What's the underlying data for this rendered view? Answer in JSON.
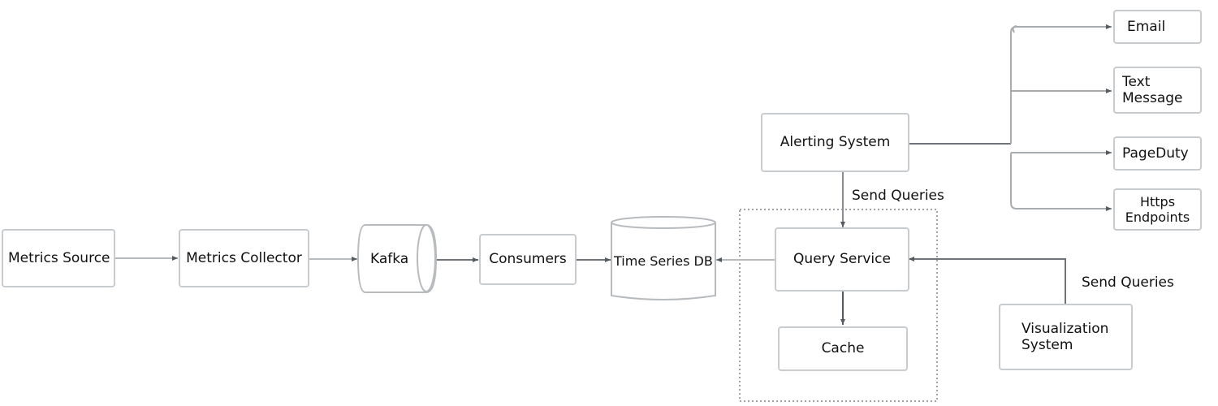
{
  "diagram": {
    "nodes": {
      "metrics_source": "Metrics Source",
      "metrics_collector": "Metrics Collector",
      "kafka": "Kafka",
      "consumers": "Consumers",
      "time_series_db": "Time Series DB",
      "query_service": "Query Service",
      "cache": "Cache",
      "alerting_system": "Alerting System",
      "visualization_system": "Visualization\nSystem",
      "email": "Email",
      "text_message": "Text\nMessage",
      "pageduty": "PageDuty",
      "https_endpoints": "Https\nEndpoints"
    },
    "edge_labels": {
      "alerting_to_query": "Send Queries",
      "visualization_to_query": "Send Queries"
    },
    "edges": [
      {
        "from": "Metrics Source",
        "to": "Metrics Collector"
      },
      {
        "from": "Metrics Collector",
        "to": "Kafka"
      },
      {
        "from": "Kafka",
        "to": "Consumers"
      },
      {
        "from": "Consumers",
        "to": "Time Series DB"
      },
      {
        "from": "Query Service",
        "to": "Time Series DB"
      },
      {
        "from": "Alerting System",
        "to": "Query Service",
        "label": "Send Queries"
      },
      {
        "from": "Visualization System",
        "to": "Query Service",
        "label": "Send Queries"
      },
      {
        "from": "Query Service",
        "to": "Cache"
      },
      {
        "from": "Alerting System",
        "to": "Email"
      },
      {
        "from": "Alerting System",
        "to": "Text Message"
      },
      {
        "from": "Alerting System",
        "to": "PageDuty"
      },
      {
        "from": "Alerting System",
        "to": "Https Endpoints"
      }
    ],
    "colors": {
      "edge": "#707478",
      "node_border": "#c9cccf",
      "group_border": "#a0a4a8"
    }
  }
}
